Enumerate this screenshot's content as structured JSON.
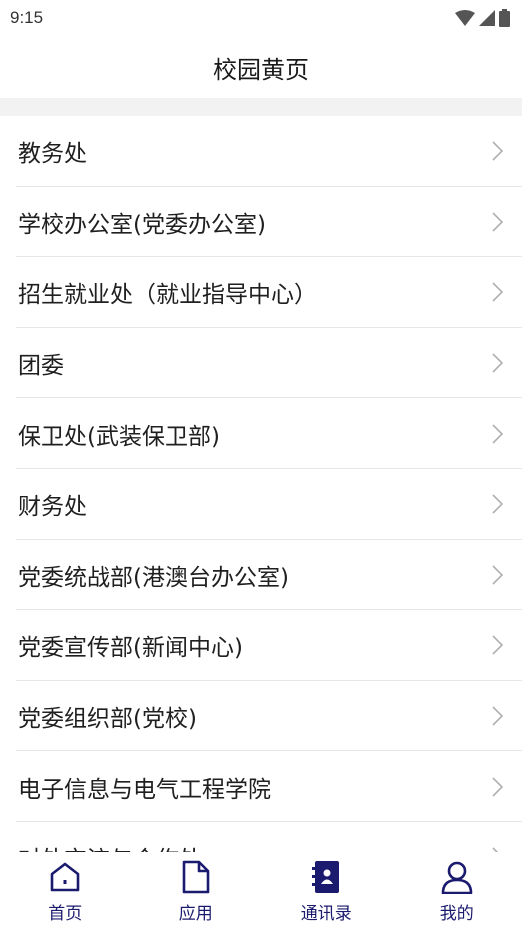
{
  "status_bar": {
    "time": "9:15"
  },
  "header": {
    "title": "校园黄页"
  },
  "directory": {
    "items": [
      {
        "label": "教务处"
      },
      {
        "label": "学校办公室(党委办公室)"
      },
      {
        "label": "招生就业处（就业指导中心）"
      },
      {
        "label": "团委"
      },
      {
        "label": "保卫处(武装保卫部)"
      },
      {
        "label": "财务处"
      },
      {
        "label": "党委统战部(港澳台办公室)"
      },
      {
        "label": "党委宣传部(新闻中心)"
      },
      {
        "label": "党委组织部(党校)"
      },
      {
        "label": "电子信息与电气工程学院"
      },
      {
        "label": "对外交流与合作处"
      }
    ]
  },
  "bottom_nav": {
    "items": [
      {
        "label": "首页",
        "icon": "home-icon"
      },
      {
        "label": "应用",
        "icon": "document-icon"
      },
      {
        "label": "通讯录",
        "icon": "contacts-book-icon",
        "active": true
      },
      {
        "label": "我的",
        "icon": "person-icon"
      }
    ]
  },
  "colors": {
    "nav_accent": "#1a1a6e",
    "chevron": "#b0b0b0",
    "band": "#f2f2f2"
  }
}
